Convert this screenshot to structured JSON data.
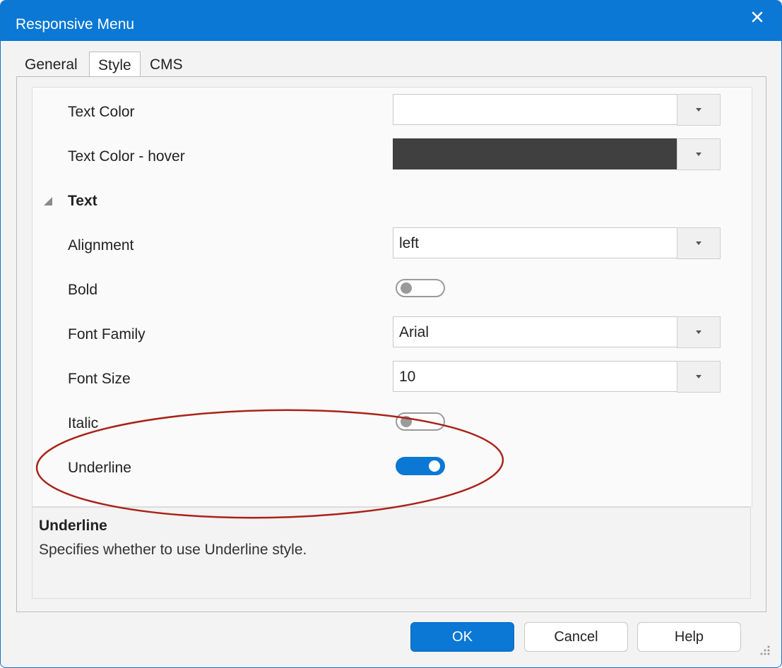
{
  "window": {
    "title": "Responsive Menu"
  },
  "tabs": [
    {
      "label": "General",
      "active": false
    },
    {
      "label": "Style",
      "active": true
    },
    {
      "label": "CMS",
      "active": false
    }
  ],
  "properties": {
    "text_color": {
      "label": "Text Color",
      "value": "",
      "swatch": "#ffffff"
    },
    "text_color_hover": {
      "label": "Text Color - hover",
      "value": "",
      "swatch": "#404040"
    },
    "section_text": {
      "label": "Text"
    },
    "alignment": {
      "label": "Alignment",
      "value": "left"
    },
    "bold": {
      "label": "Bold",
      "on": false
    },
    "font_family": {
      "label": "Font Family",
      "value": "Arial"
    },
    "font_size": {
      "label": "Font Size",
      "value": "10"
    },
    "italic": {
      "label": "Italic",
      "on": false
    },
    "underline": {
      "label": "Underline",
      "on": true
    }
  },
  "description": {
    "title": "Underline",
    "text": "Specifies whether to use Underline style."
  },
  "buttons": {
    "ok": "OK",
    "cancel": "Cancel",
    "help": "Help"
  },
  "colors": {
    "accent": "#0a78d4",
    "annotation": "#a8231a"
  }
}
